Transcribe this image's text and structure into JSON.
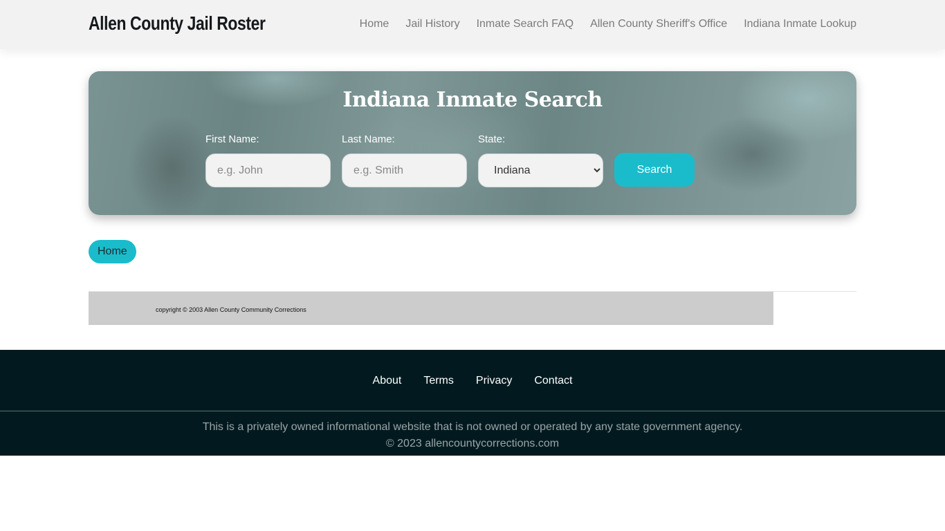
{
  "header": {
    "brand": "Allen County Jail Roster",
    "nav": [
      {
        "label": "Home"
      },
      {
        "label": "Jail History"
      },
      {
        "label": "Inmate Search FAQ"
      },
      {
        "label": "Allen County Sheriff's Office"
      },
      {
        "label": "Indiana Inmate Lookup"
      }
    ]
  },
  "search": {
    "title": "Indiana Inmate Search",
    "first_name": {
      "label": "First Name:",
      "placeholder": "e.g. John",
      "value": ""
    },
    "last_name": {
      "label": "Last Name:",
      "placeholder": "e.g. Smith",
      "value": ""
    },
    "state": {
      "label": "State:",
      "selected": "Indiana"
    },
    "button_label": "Search",
    "accent_color": "#1abccb"
  },
  "breadcrumb": {
    "items": [
      {
        "label": "Home"
      }
    ]
  },
  "legacy_footer": {
    "text": "copyright © 2003 Allen County Community Corrections"
  },
  "footer": {
    "links": [
      {
        "label": "About"
      },
      {
        "label": "Terms"
      },
      {
        "label": "Privacy"
      },
      {
        "label": "Contact"
      }
    ],
    "disclaimer": "This is a privately owned informational website that is not owned or operated by any state government agency.",
    "copyright": "© 2023 allencountycorrections.com"
  }
}
